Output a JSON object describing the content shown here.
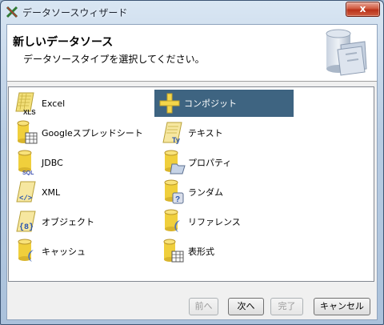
{
  "window": {
    "title": "データソースウィザード",
    "close_label": "x"
  },
  "header": {
    "title": "新しいデータソース",
    "subtitle": "データソースタイプを選択してください。"
  },
  "sources": {
    "left": [
      {
        "label": "Excel",
        "icon": "excel-xls-icon"
      },
      {
        "label": "Googleスプレッドシート",
        "icon": "database-sheet-icon"
      },
      {
        "label": "JDBC",
        "icon": "database-sql-icon"
      },
      {
        "label": "XML",
        "icon": "xml-document-icon"
      },
      {
        "label": "オブジェクト",
        "icon": "object-document-icon"
      },
      {
        "label": "キャッシュ",
        "icon": "database-cache-icon"
      }
    ],
    "right": [
      {
        "label": "コンポジット",
        "icon": "plus-icon",
        "selected": true
      },
      {
        "label": "テキスト",
        "icon": "text-document-icon"
      },
      {
        "label": "プロパティ",
        "icon": "database-folder-icon"
      },
      {
        "label": "ランダム",
        "icon": "database-random-icon"
      },
      {
        "label": "リファレンス",
        "icon": "database-reference-icon"
      },
      {
        "label": "表形式",
        "icon": "database-table-icon"
      }
    ]
  },
  "buttons": {
    "back": "前へ",
    "next": "次へ",
    "finish": "完了",
    "cancel": "キャンセル"
  },
  "colors": {
    "selection": "#3e6481",
    "icon_yellow": "#f3d64b"
  }
}
